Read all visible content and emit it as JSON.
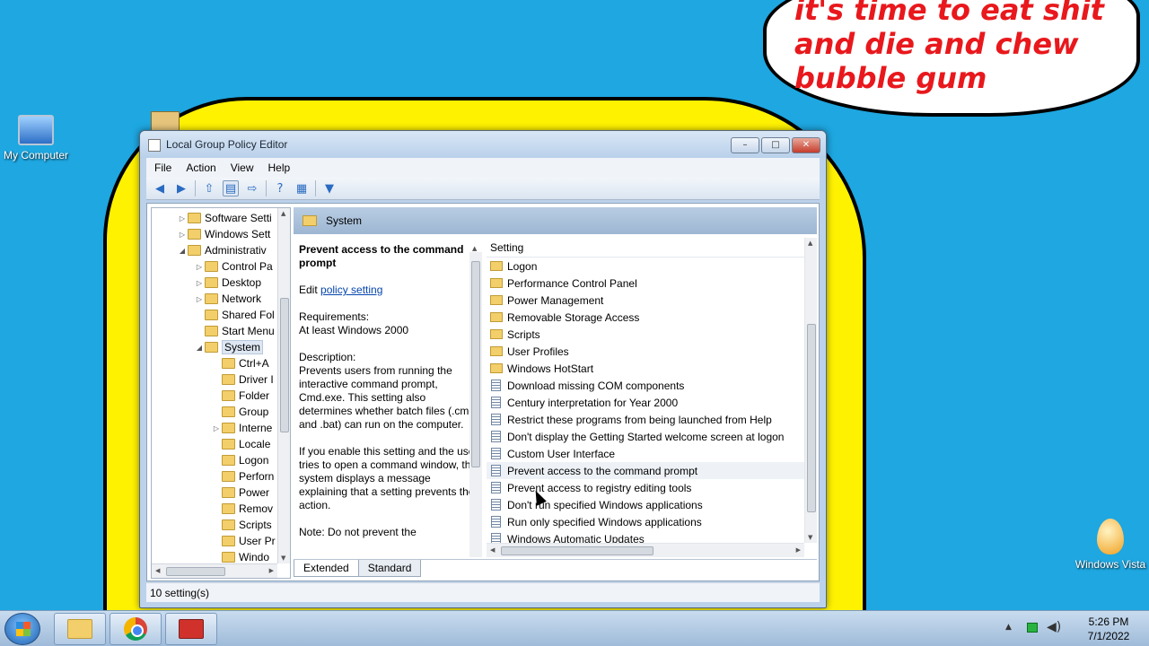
{
  "wallpaper": {
    "bubble_text": "it's time to eat shit and die and chew bubble gum"
  },
  "desktop_icons": [
    {
      "label": "My Computer",
      "icon": "computer-icon"
    },
    {
      "label": "Windows Vista",
      "icon": "egg-icon"
    }
  ],
  "window": {
    "title": "Local Group Policy Editor",
    "controls": {
      "minimize": "–",
      "maximize": "□",
      "close": "✕"
    }
  },
  "menu": [
    "File",
    "Action",
    "View",
    "Help"
  ],
  "toolbar": {
    "icons": [
      "back-icon",
      "forward-icon",
      "up-icon",
      "show-tree-icon",
      "export-icon",
      "help-icon",
      "view-icon",
      "filter-icon"
    ]
  },
  "tree": {
    "items": [
      {
        "label": "Software Setti",
        "level": 1,
        "arrow": "▷"
      },
      {
        "label": "Windows Sett",
        "level": 1,
        "arrow": "▷"
      },
      {
        "label": "Administrativ",
        "level": 1,
        "arrow": "◢"
      },
      {
        "label": "Control Pa",
        "level": 2,
        "arrow": "▷"
      },
      {
        "label": "Desktop",
        "level": 2,
        "arrow": "▷"
      },
      {
        "label": "Network",
        "level": 2,
        "arrow": "▷"
      },
      {
        "label": "Shared Fol",
        "level": 2,
        "arrow": ""
      },
      {
        "label": "Start Menu",
        "level": 2,
        "arrow": ""
      },
      {
        "label": "System",
        "level": 2,
        "arrow": "◢",
        "selected": true
      },
      {
        "label": "Ctrl+A",
        "level": 3,
        "arrow": ""
      },
      {
        "label": "Driver I",
        "level": 3,
        "arrow": ""
      },
      {
        "label": "Folder",
        "level": 3,
        "arrow": ""
      },
      {
        "label": "Group",
        "level": 3,
        "arrow": ""
      },
      {
        "label": "Interne",
        "level": 3,
        "arrow": "▷"
      },
      {
        "label": "Locale",
        "level": 3,
        "arrow": ""
      },
      {
        "label": "Logon",
        "level": 3,
        "arrow": ""
      },
      {
        "label": "Perforn",
        "level": 3,
        "arrow": ""
      },
      {
        "label": "Power",
        "level": 3,
        "arrow": ""
      },
      {
        "label": "Remov",
        "level": 3,
        "arrow": ""
      },
      {
        "label": "Scripts",
        "level": 3,
        "arrow": ""
      },
      {
        "label": "User Pr",
        "level": 3,
        "arrow": ""
      },
      {
        "label": "Windo",
        "level": 3,
        "arrow": ""
      }
    ]
  },
  "pane": {
    "header": "System",
    "description": {
      "title": "Prevent access to the command prompt",
      "edit_prefix": "Edit",
      "edit_link": "policy setting",
      "requirements_label": "Requirements:",
      "requirements": "At least Windows 2000",
      "description_label": "Description:",
      "description": "Prevents users from running the interactive command prompt, Cmd.exe. This setting also determines whether batch files (.cmd and .bat) can run on the computer.",
      "paragraph2": "If you enable this setting and the user tries to open a command window, the system displays a message explaining that a setting prevents the action.",
      "note": "Note: Do not prevent the"
    },
    "list_header": "Setting",
    "items": [
      {
        "label": "Logon",
        "kind": "folder"
      },
      {
        "label": "Performance Control Panel",
        "kind": "folder"
      },
      {
        "label": "Power Management",
        "kind": "folder"
      },
      {
        "label": "Removable Storage Access",
        "kind": "folder"
      },
      {
        "label": "Scripts",
        "kind": "folder"
      },
      {
        "label": "User Profiles",
        "kind": "folder"
      },
      {
        "label": "Windows HotStart",
        "kind": "folder"
      },
      {
        "label": "Download missing COM components",
        "kind": "policy"
      },
      {
        "label": "Century interpretation for Year 2000",
        "kind": "policy"
      },
      {
        "label": "Restrict these programs from being launched from Help",
        "kind": "policy"
      },
      {
        "label": "Don't display the Getting Started welcome screen at logon",
        "kind": "policy"
      },
      {
        "label": "Custom User Interface",
        "kind": "policy"
      },
      {
        "label": "Prevent access to the command prompt",
        "kind": "policy",
        "highlighted": true
      },
      {
        "label": "Prevent access to registry editing tools",
        "kind": "policy"
      },
      {
        "label": "Don't run specified Windows applications",
        "kind": "policy"
      },
      {
        "label": "Run only specified Windows applications",
        "kind": "policy"
      },
      {
        "label": "Windows Automatic Updates",
        "kind": "policy"
      }
    ],
    "tabs": [
      "Extended",
      "Standard"
    ]
  },
  "status": "10 setting(s)",
  "taskbar": {
    "apps": [
      "explorer-icon",
      "chrome-icon",
      "toolbox-icon"
    ],
    "time": "5:26 PM",
    "date": "7/1/2022"
  },
  "colors": {
    "desktop": "#1ea7e1",
    "figure": "#fff200",
    "bubble_text": "#e8181c"
  }
}
